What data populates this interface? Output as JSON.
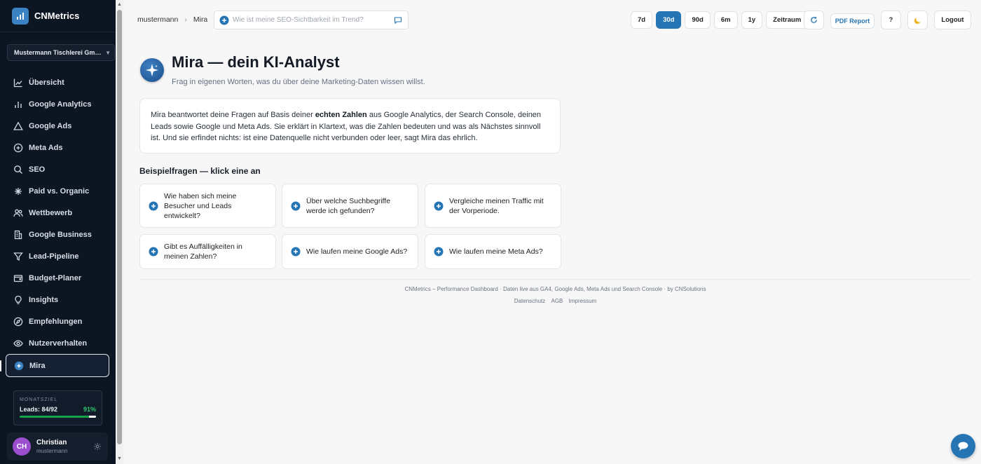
{
  "app": {
    "name": "CNMetrics"
  },
  "sidebar": {
    "company": "Mustermann Tischlerei Gmb...",
    "items": [
      {
        "label": "Übersicht",
        "icon": "line-chart-icon"
      },
      {
        "label": "Google Analytics",
        "icon": "bar-chart-icon"
      },
      {
        "label": "Google Ads",
        "icon": "triangle-icon"
      },
      {
        "label": "Meta Ads",
        "icon": "circle-plus-icon"
      },
      {
        "label": "SEO",
        "icon": "search-icon"
      },
      {
        "label": "Paid vs. Organic",
        "icon": "sparkle-icon"
      },
      {
        "label": "Wettbewerb",
        "icon": "users-icon"
      },
      {
        "label": "Google Business",
        "icon": "building-icon"
      },
      {
        "label": "Lead-Pipeline",
        "icon": "funnel-icon"
      },
      {
        "label": "Budget-Planer",
        "icon": "wallet-icon"
      },
      {
        "label": "Insights",
        "icon": "lightbulb-icon"
      },
      {
        "label": "Empfehlungen",
        "icon": "compass-icon"
      },
      {
        "label": "Nutzerverhalten",
        "icon": "eye-icon"
      },
      {
        "label": "Mira",
        "icon": "mira-sparkle-icon",
        "active": true
      }
    ],
    "goal": {
      "title": "MONATSZIEL",
      "label": "Leads: 84/92",
      "percent": "91%",
      "progress": 0.91
    },
    "user": {
      "initials": "CH",
      "name": "Christian",
      "username": "mustermann"
    }
  },
  "topbar": {
    "breadcrumb": [
      "mustermann",
      "Mira"
    ],
    "ask_placeholder": "Wie ist meine SEO-Sichtbarkeit im Trend?",
    "periods": [
      {
        "label": "7d",
        "active": false
      },
      {
        "label": "30d",
        "active": true
      },
      {
        "label": "90d",
        "active": false
      },
      {
        "label": "6m",
        "active": false
      },
      {
        "label": "1y",
        "active": false
      },
      {
        "label": "Zeitraum",
        "active": false
      }
    ],
    "pdf_label": "PDF Report",
    "help_label": "?",
    "logout_label": "Logout"
  },
  "main": {
    "title": "Mira — dein KI-Analyst",
    "subtitle": "Frag in eigenen Worten, was du über deine Marketing-Daten wissen willst.",
    "intro_before": "Mira beantwortet deine Fragen auf Basis deiner ",
    "intro_bold": "echten Zahlen",
    "intro_after": " aus Google Analytics, der Search Console, deinen Leads sowie Google und Meta Ads. Sie erklärt in Klartext, was die Zahlen bedeuten und was als Nächstes sinnvoll ist. Und sie erfindet nichts: ist eine Datenquelle nicht verbunden oder leer, sagt Mira das ehrlich.",
    "examples_title": "Beispielfragen — klick eine an",
    "examples": [
      "Wie haben sich meine Besucher und Leads entwickelt?",
      "Über welche Suchbegriffe werde ich gefunden?",
      "Vergleiche meinen Traffic mit der Vorperiode.",
      "Gibt es Auffälligkeiten in meinen Zahlen?",
      "Wie laufen meine Google Ads?",
      "Wie laufen meine Meta Ads?"
    ]
  },
  "footer": {
    "text": "CNMetrics – Performance Dashboard · Daten live aus GA4, Google Ads, Meta Ads und Search Console · by CNSolutions",
    "links": [
      "Datenschutz",
      "AGB",
      "Impressum"
    ]
  },
  "colors": {
    "accent": "#2574b4",
    "sidebar_bg": "#0c1522",
    "goal_green": "#16a34a",
    "avatar": "#9b4fd0"
  }
}
